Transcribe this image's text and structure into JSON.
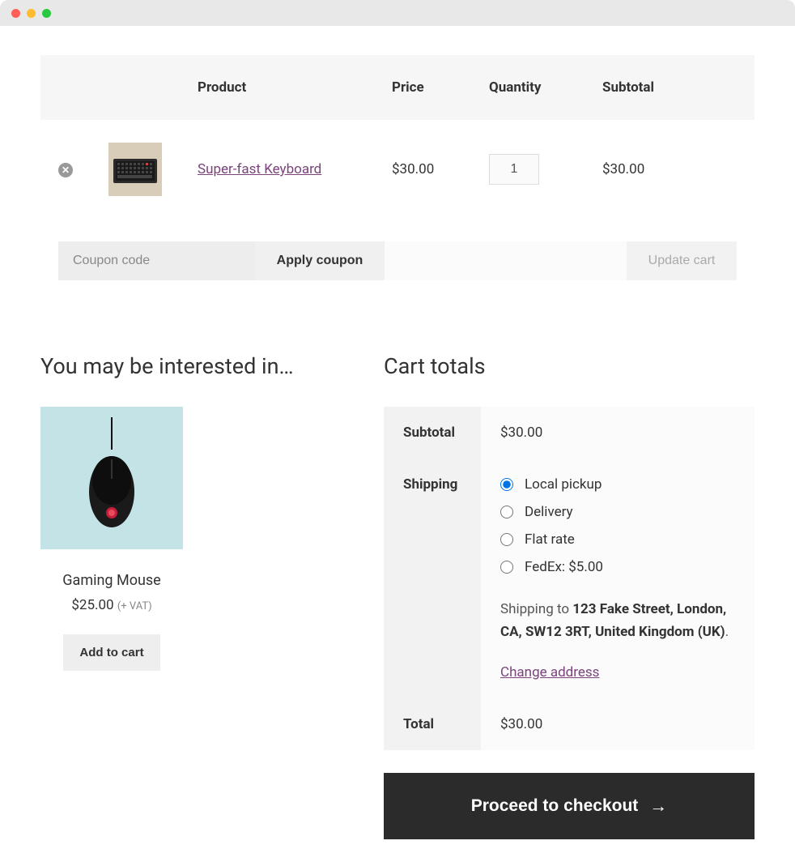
{
  "cart": {
    "headers": {
      "product": "Product",
      "price": "Price",
      "quantity": "Quantity",
      "subtotal": "Subtotal"
    },
    "items": [
      {
        "name": "Super-fast Keyboard",
        "price": "$30.00",
        "quantity": "1",
        "subtotal": "$30.00"
      }
    ],
    "coupon_placeholder": "Coupon code",
    "apply_coupon_label": "Apply coupon",
    "update_cart_label": "Update cart"
  },
  "interested": {
    "heading": "You may be interested in…",
    "products": [
      {
        "name": "Gaming Mouse",
        "price": "$25.00",
        "vat_suffix": "(+ VAT)",
        "add_label": "Add to cart"
      }
    ]
  },
  "totals": {
    "heading": "Cart totals",
    "rows": {
      "subtotal_label": "Subtotal",
      "subtotal_value": "$30.00",
      "shipping_label": "Shipping",
      "total_label": "Total",
      "total_value": "$30.00"
    },
    "shipping_options": [
      {
        "label": "Local pickup",
        "checked": true
      },
      {
        "label": "Delivery",
        "checked": false
      },
      {
        "label": "Flat rate",
        "checked": false
      },
      {
        "label": "FedEx: $5.00",
        "checked": false
      }
    ],
    "shipping_to_prefix": "Shipping to ",
    "shipping_address": "123 Fake Street, London, CA, SW12 3RT, United Kingdom (UK)",
    "shipping_to_suffix": ".",
    "change_address_label": "Change address",
    "checkout_label": "Proceed to checkout"
  }
}
